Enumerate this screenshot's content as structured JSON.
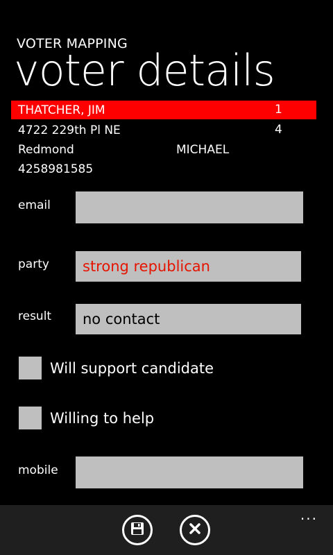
{
  "header": {
    "app_title": "VOTER MAPPING",
    "page_title": "voter details"
  },
  "voter": {
    "name": "THATCHER, JIM",
    "number_1": "1",
    "address": "4722 229th Pl NE",
    "number_2": "4",
    "city": "Redmond",
    "secondary_name": "MICHAEL",
    "phone": "4258981585"
  },
  "form": {
    "email_label": "email",
    "email_value": "",
    "party_label": "party",
    "party_value": "strong republican",
    "result_label": "result",
    "result_value": "no contact",
    "support_label": "Will support candidate",
    "support_checked": false,
    "help_label": "Willing to help",
    "help_checked": false,
    "mobile_label": "mobile",
    "mobile_value": ""
  },
  "appbar": {
    "buttons": [
      "save-icon",
      "cancel-icon"
    ],
    "more": "..."
  },
  "colors": {
    "accent": "#ff0000",
    "party_text": "#e51400",
    "field_bg": "#bfbfbf",
    "appbar_bg": "#1f1f1f"
  }
}
